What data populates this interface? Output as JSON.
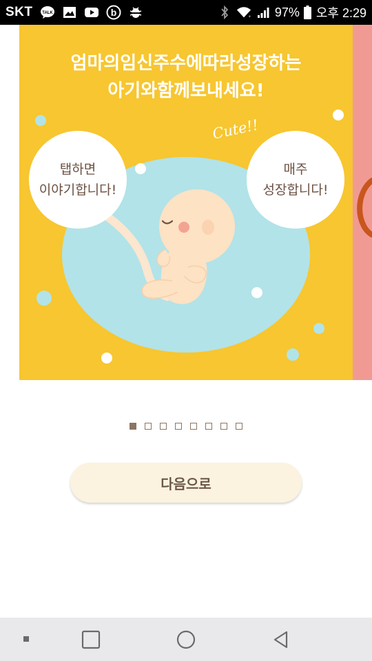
{
  "status_bar": {
    "carrier": "SKT",
    "battery": "97%",
    "time": "오후 2:29",
    "icons": [
      "kakaotalk-icon",
      "gallery-icon",
      "youtube-icon",
      "band-icon",
      "debug-icon",
      "bluetooth-icon",
      "wifi-icon",
      "signal-icon",
      "battery-icon"
    ]
  },
  "slide": {
    "headline_line1": "엄마의임신주수에따라성장하는",
    "headline_line2": "아기와함께보내세요!",
    "bubble_left_line1": "탭하면",
    "bubble_left_line2": "이야기합니다!",
    "bubble_right_line1": "매주",
    "bubble_right_line2": "성장합니다!",
    "cute_text": "Cute!!",
    "background_color": "#f7c630",
    "next_slide_color": "#f19a94"
  },
  "pager": {
    "total": 8,
    "active_index": 0
  },
  "next_button": {
    "label": "다음으로"
  },
  "nav_bar": {
    "icons": [
      "menu-dot-icon",
      "recent-apps-icon",
      "home-icon",
      "back-icon"
    ]
  }
}
